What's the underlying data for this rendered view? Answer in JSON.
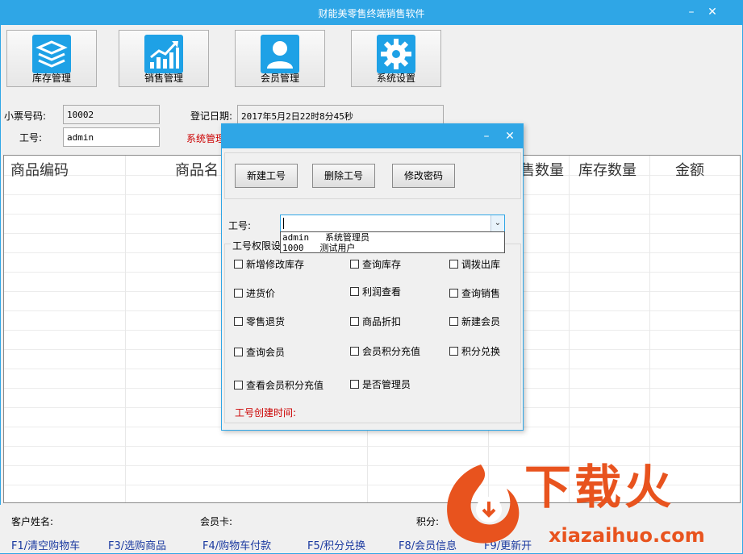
{
  "window": {
    "title": "财能美零售终端销售软件"
  },
  "toolbar": [
    {
      "label": "库存管理",
      "icon": "layers-icon"
    },
    {
      "label": "销售管理",
      "icon": "bar-chart-icon"
    },
    {
      "label": "会员管理",
      "icon": "user-icon"
    },
    {
      "label": "系统设置",
      "icon": "gear-icon"
    }
  ],
  "form": {
    "receipt_label": "小票号码:",
    "receipt_value": "10002",
    "date_label": "登记日期:",
    "date_value": "2017年5月2日22时8分45秒",
    "staff_label": "工号:",
    "staff_value": "admin",
    "role_text": "系统管理"
  },
  "grid": {
    "headers": [
      "商品编码",
      "商品名",
      "售数量",
      "库存数量",
      "金额"
    ]
  },
  "bottom": {
    "customer_label": "客户姓名:",
    "card_label": "会员卡:",
    "points_label": "积分:",
    "fkeys": [
      "F1/清空购物车",
      "F3/选购商品",
      "F4/购物车付款",
      "F5/积分兑换",
      "F8/会员信息",
      "F9/更新开"
    ]
  },
  "dialog": {
    "buttons": {
      "new": "新建工号",
      "delete": "删除工号",
      "password": "修改密码"
    },
    "staff_label": "工号:",
    "staff_value": "",
    "options": [
      "admin   系统管理员",
      "1000   测试用户"
    ],
    "perm_title": "工号权限设",
    "permissions": [
      "新增修改库存",
      "查询库存",
      "调拨出库",
      "进货价",
      "利润查看",
      "查询销售",
      "零售退货",
      "商品折扣",
      "新建会员",
      "查询会员",
      "会员积分充值",
      "积分兑换",
      "查看会员积分充值",
      "是否管理员"
    ],
    "created_label": "工号创建时间:"
  },
  "watermark": {
    "text": "下载火",
    "url": "xiazaihuo.com"
  },
  "colors": {
    "accent": "#2fa6e6",
    "icon_blue": "#1ea1e6",
    "red": "#cc0000",
    "link_blue": "#1b3aa0",
    "watermark_orange": "#e8531e"
  }
}
